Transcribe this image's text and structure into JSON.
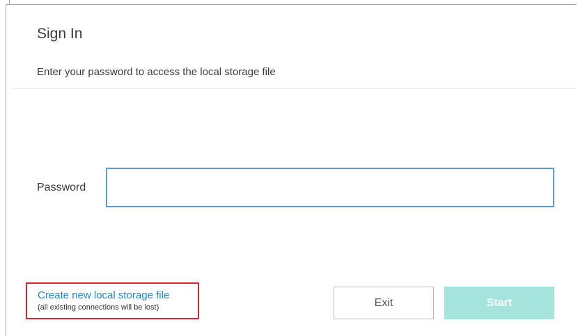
{
  "dialog": {
    "title": "Sign In",
    "subtitle": "Enter your password to access the local storage file"
  },
  "password": {
    "label": "Password",
    "value": "",
    "placeholder": ""
  },
  "create_storage": {
    "link_text": "Create new local storage file",
    "note": "(all existing connections will be lost)",
    "link_color": "#1e88c7",
    "highlight_color": "#d9232d"
  },
  "buttons": {
    "exit_label": "Exit",
    "start_label": "Start",
    "start_color": "#a4e4dd"
  }
}
